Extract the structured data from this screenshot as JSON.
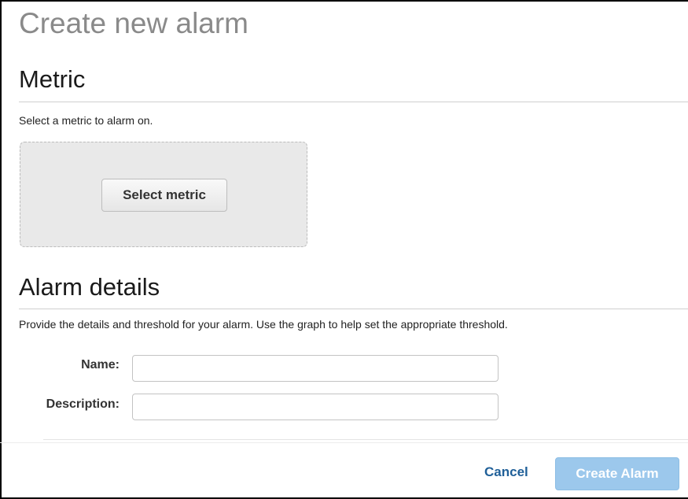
{
  "page_title": "Create new alarm",
  "metric": {
    "heading": "Metric",
    "help_text": "Select a metric to alarm on.",
    "select_button_label": "Select metric"
  },
  "alarm_details": {
    "heading": "Alarm details",
    "help_text": "Provide the details and threshold for your alarm. Use the graph to help set the appropriate threshold.",
    "name_label": "Name:",
    "name_value": "",
    "description_label": "Description:",
    "description_value": ""
  },
  "footer": {
    "cancel_label": "Cancel",
    "create_label": "Create Alarm",
    "create_enabled": false
  },
  "colors": {
    "title_gray": "#8a8a8a",
    "link_blue": "#1f5f98",
    "disabled_primary": "#9cc8ec"
  }
}
